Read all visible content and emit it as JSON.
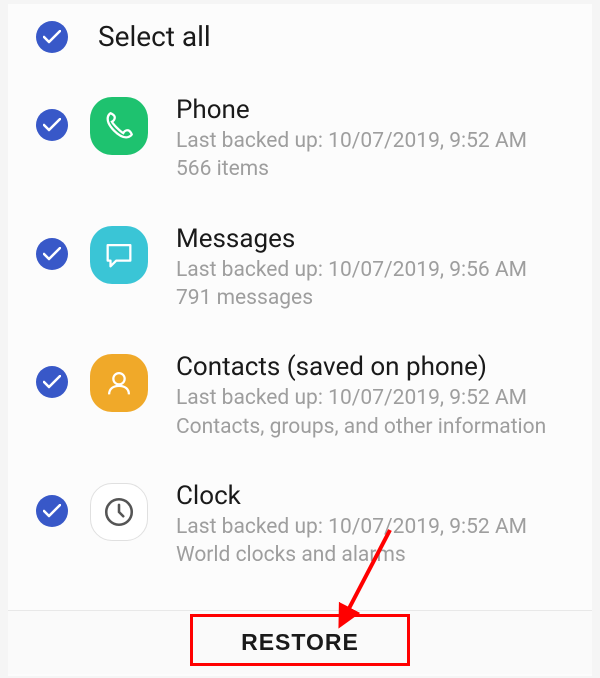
{
  "selectAll": {
    "label": "Select all"
  },
  "items": [
    {
      "title": "Phone",
      "line1": "Last backed up: 10/07/2019, 9:52 AM",
      "line2": "566 items"
    },
    {
      "title": "Messages",
      "line1": "Last backed up: 10/07/2019, 9:56 AM",
      "line2": "791 messages"
    },
    {
      "title": "Contacts (saved on phone)",
      "line1": "Last backed up: 10/07/2019, 9:52 AM",
      "line2": "Contacts, groups, and other information"
    },
    {
      "title": "Clock",
      "line1": "Last backed up: 10/07/2019, 9:52 AM",
      "line2": "World clocks and alarms"
    }
  ],
  "footer": {
    "restore": "RESTORE"
  }
}
